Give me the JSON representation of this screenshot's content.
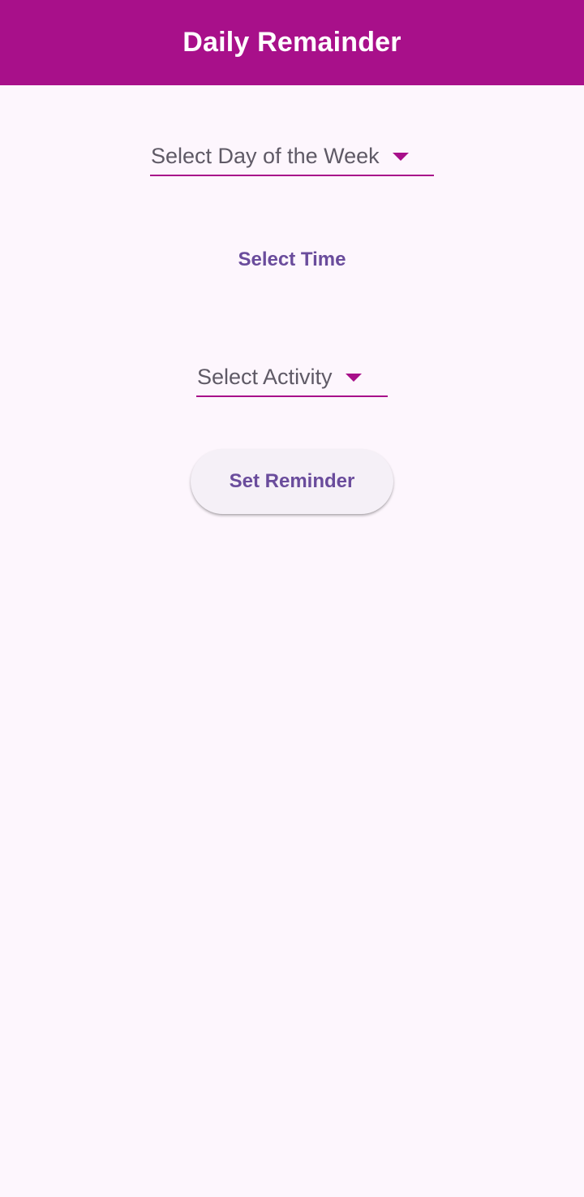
{
  "app_bar": {
    "title": "Daily Remainder"
  },
  "form": {
    "day_dropdown": {
      "value": "Select Day of the Week",
      "icon": "arrow-drop-down-icon"
    },
    "time_button": {
      "label": "Select Time"
    },
    "activity_dropdown": {
      "value": "Select Activity",
      "icon": "arrow-drop-down-icon"
    },
    "set_reminder_button": {
      "label": "Set Reminder"
    }
  },
  "colors": {
    "primary": "#a8108a",
    "background": "#fdf6fd",
    "button_text": "#6a4c9c",
    "dropdown_text": "#5f5a66",
    "button_background": "#f5f0f7"
  }
}
